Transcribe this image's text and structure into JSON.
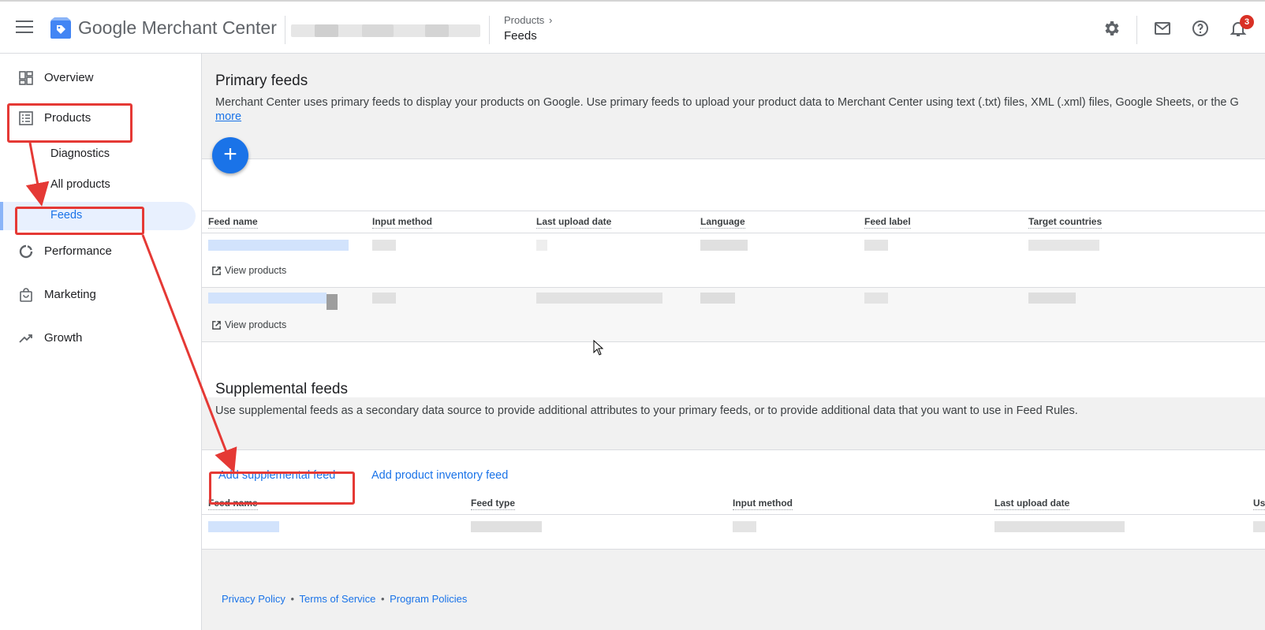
{
  "header": {
    "brand_name": "Google",
    "brand_product": "Merchant Center",
    "breadcrumb_parent": "Products",
    "breadcrumb_current": "Feeds",
    "notification_count": "3"
  },
  "sidebar": {
    "items": [
      {
        "label": "Overview",
        "icon": "dashboard-icon"
      },
      {
        "label": "Products",
        "icon": "list-icon"
      },
      {
        "label": "Diagnostics"
      },
      {
        "label": "All products"
      },
      {
        "label": "Feeds",
        "active": true
      },
      {
        "label": "Performance",
        "icon": "donut-chart-icon"
      },
      {
        "label": "Marketing",
        "icon": "shopping-bag-icon"
      },
      {
        "label": "Growth",
        "icon": "trending-up-icon"
      }
    ]
  },
  "primary_feeds": {
    "title": "Primary feeds",
    "description": "Merchant Center uses primary feeds to display your products on Google. Use primary feeds to upload your product data to Merchant Center using text (.txt) files, XML (.xml) files, Google Sheets, or the G",
    "more_link": "more",
    "add_button": "+",
    "columns": [
      "Feed name",
      "Input method",
      "Last upload date",
      "Language",
      "Feed label",
      "Target countries"
    ],
    "rows": [
      {
        "view_products": "View products"
      },
      {
        "view_products": "View products"
      }
    ]
  },
  "supplemental_feeds": {
    "title": "Supplemental feeds",
    "description": "Use supplemental feeds as a secondary data source to provide additional attributes to your primary feeds, or to provide additional data that you want to use in Feed Rules.",
    "add_supplemental": "Add supplemental feed",
    "add_inventory": "Add product inventory feed",
    "columns": [
      "Feed name",
      "Feed type",
      "Input method",
      "Last upload date",
      "Us"
    ]
  },
  "footer": {
    "privacy": "Privacy Policy",
    "separator": "•",
    "terms": "Terms of Service",
    "program": "Program Policies"
  },
  "colors": {
    "accent": "#1a73e8",
    "highlight": "#e53935",
    "badge": "#d93025"
  }
}
